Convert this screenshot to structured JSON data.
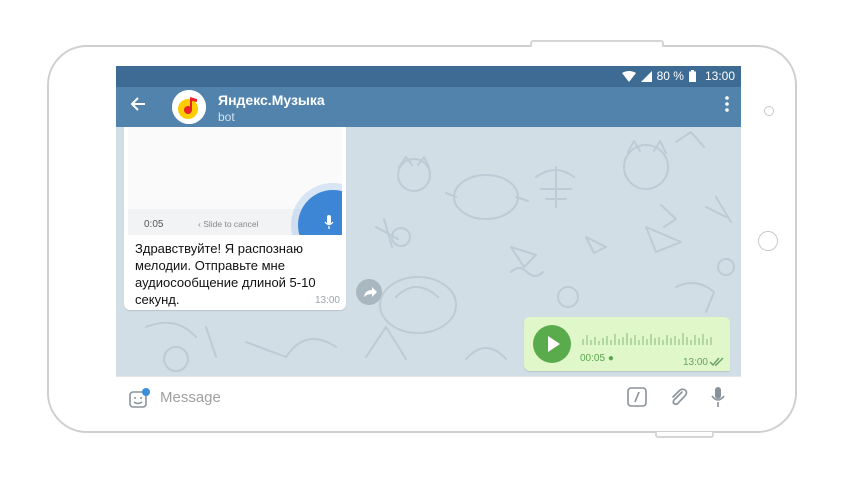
{
  "status": {
    "percent": "80 %",
    "time": "13:00"
  },
  "header": {
    "back_icon": "arrow-left-icon",
    "title": "Яндекс.Музыка",
    "subtitle": "bot",
    "menu_icon": "more-vertical-icon"
  },
  "incoming": {
    "preview": {
      "time": "0:05",
      "slide_text": "Slide to cancel"
    },
    "text": "Здравствуйте! Я распознаю мелодии. Отправьте мне аудиосообщение длиной 5-10 секунд.",
    "time": "13:00"
  },
  "outgoing": {
    "duration": "00:05",
    "time": "13:00"
  },
  "input": {
    "placeholder": "Message"
  },
  "colors": {
    "header": "#5183ad",
    "statusbar": "#3e6b94",
    "chat_bg": "#d2dee6",
    "outgoing_bubble": "#e0f7c9",
    "play": "#5aab4c"
  }
}
